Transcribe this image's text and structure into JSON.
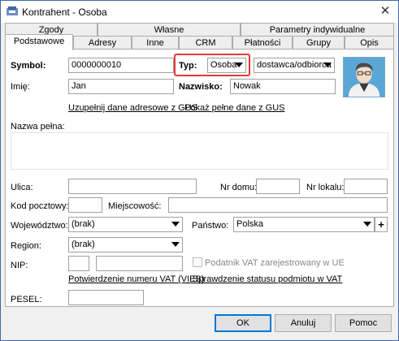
{
  "window": {
    "title": "Kontrahent - Osoba"
  },
  "tabs_row1": [
    "Zgody",
    "Własne",
    "Parametry indywidualne"
  ],
  "tabs_row2": [
    "Podstawowe",
    "Adresy",
    "Inne",
    "CRM",
    "Płatności",
    "Grupy",
    "Opis"
  ],
  "form": {
    "symbol_label": "Symbol:",
    "symbol_value": "0000000010",
    "typ_label": "Typ:",
    "typ_value": "Osoba",
    "rodzaj_value": "dostawca/odbiorca",
    "imie_label": "Imię:",
    "imie_value": "Jan",
    "nazwisko_label": "Nazwisko:",
    "nazwisko_value": "Nowak",
    "gus_link": "Uzupełnij dane adresowe z GUS",
    "gus_full_link": "Pokaż pełne dane z GUS",
    "nazwa_pelna_label": "Nazwa pełna:",
    "ulica_label": "Ulica:",
    "nr_domu_label": "Nr domu:",
    "nr_lokalu_label": "Nr lokalu:",
    "kod_label": "Kod pocztowy:",
    "miejscowosc_label": "Miejscowość:",
    "wojewodztwo_label": "Województwo:",
    "wojewodztwo_value": "(brak)",
    "panstwo_label": "Państwo:",
    "panstwo_value": "Polska",
    "region_label": "Region:",
    "region_value": "(brak)",
    "nip_label": "NIP:",
    "vat_ue_label": "Podatnik VAT zarejestrowany w UE",
    "vies_link": "Potwierdzenie numeru VAT (VIES)",
    "status_link": "Sprawdzenie statusu podmiotu w VAT",
    "pesel_label": "PESEL:"
  },
  "buttons": {
    "ok": "OK",
    "cancel": "Anuluj",
    "help": "Pomoc"
  },
  "colors": {
    "highlight": "#e03a3a",
    "default_button_border": "#0078d7"
  }
}
